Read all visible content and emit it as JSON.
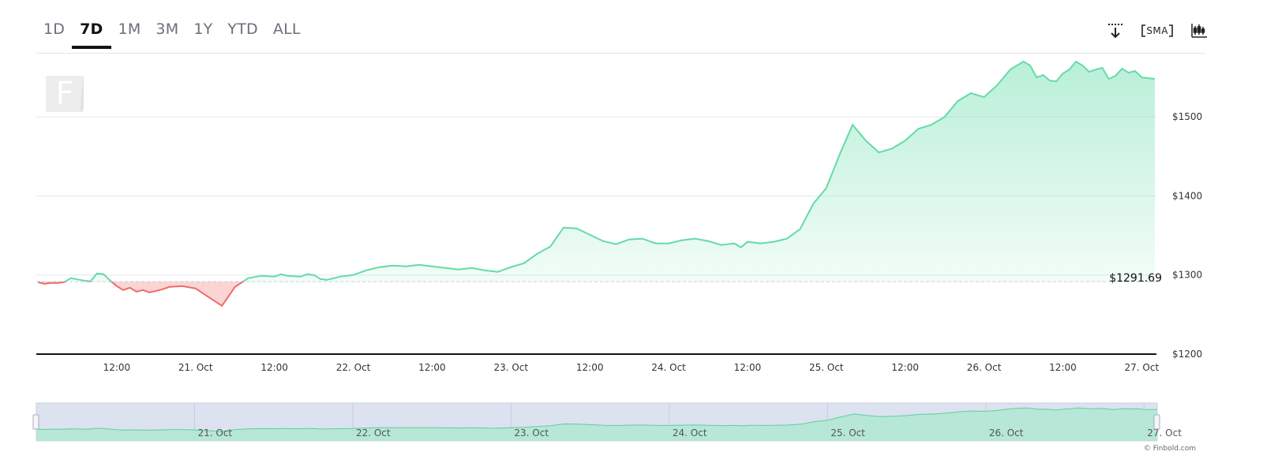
{
  "range_tabs": [
    {
      "label": "1D",
      "active": false
    },
    {
      "label": "7D",
      "active": true
    },
    {
      "label": "1M",
      "active": false
    },
    {
      "label": "3M",
      "active": false
    },
    {
      "label": "1Y",
      "active": false
    },
    {
      "label": "YTD",
      "active": false
    },
    {
      "label": "ALL",
      "active": false
    }
  ],
  "toolbar": {
    "download_icon": "download-icon",
    "sma_label": "SMA",
    "candlestick_icon": "candlestick-icon"
  },
  "watermark_letter": "F",
  "credit": "© Finbold.com",
  "colors": {
    "up": "#64dba6",
    "down": "#f06a6a",
    "up_fill": "#c9f3df",
    "down_fill": "#fbd4d4",
    "axis": "#111318",
    "grid": "#e6e8ec",
    "navigator_bg": "#dde2f0"
  },
  "chart_data": {
    "type": "line",
    "reference_value": 1291.69,
    "reference_label": "$1291.69",
    "ylim": [
      1200,
      1580
    ],
    "y_ticks": [
      1200,
      1300,
      1400,
      1500
    ],
    "y_tick_labels": [
      "$1200",
      "$1300",
      "$1400",
      "$1500"
    ],
    "x_tick_labels": [
      "12:00",
      "21. Oct",
      "12:00",
      "22. Oct",
      "12:00",
      "23. Oct",
      "12:00",
      "24. Oct",
      "12:00",
      "25. Oct",
      "12:00",
      "26. Oct",
      "12:00",
      "27. Oct"
    ],
    "navigator_labels": [
      "21. Oct",
      "22. Oct",
      "23. Oct",
      "24. Oct",
      "25. Oct",
      "26. Oct",
      "27. Oct"
    ],
    "x_unit": "hour",
    "x_range": [
      0,
      170
    ],
    "x": [
      0,
      1,
      2,
      3,
      4,
      5,
      7,
      8,
      9,
      10,
      11,
      12,
      13,
      14,
      15,
      16,
      17,
      18,
      19,
      20,
      22,
      24,
      26,
      28,
      30,
      32,
      34,
      36,
      37,
      38,
      40,
      41,
      42,
      43,
      44,
      46,
      48,
      50,
      52,
      54,
      56,
      58,
      60,
      62,
      64,
      66,
      68,
      70,
      72,
      74,
      76,
      78,
      80,
      82,
      84,
      86,
      88,
      90,
      92,
      94,
      96,
      98,
      100,
      102,
      104,
      106,
      107,
      108,
      109,
      110,
      112,
      114,
      116,
      118,
      120,
      122,
      124,
      126,
      128,
      130,
      132,
      134,
      136,
      138,
      140,
      142,
      144,
      146,
      148,
      150,
      151,
      152,
      153,
      154,
      155,
      156,
      157,
      158,
      159,
      160,
      161,
      162,
      163,
      164,
      165,
      166,
      167,
      168,
      170
    ],
    "values": [
      1291,
      1289,
      1290,
      1290,
      1291,
      1296,
      1293,
      1292,
      1302,
      1301,
      1293,
      1286,
      1281,
      1284,
      1279,
      1281,
      1278,
      1280,
      1282,
      1285,
      1286,
      1283,
      1272,
      1261,
      1285,
      1296,
      1299,
      1298,
      1301,
      1299,
      1298,
      1301,
      1300,
      1295,
      1294,
      1298,
      1300,
      1306,
      1310,
      1312,
      1311,
      1313,
      1311,
      1309,
      1307,
      1309,
      1306,
      1304,
      1310,
      1315,
      1327,
      1336,
      1360,
      1359,
      1351,
      1343,
      1339,
      1345,
      1346,
      1340,
      1340,
      1344,
      1346,
      1343,
      1338,
      1340,
      1335,
      1342,
      1341,
      1340,
      1342,
      1346,
      1358,
      1390,
      1410,
      1452,
      1490,
      1470,
      1455,
      1460,
      1470,
      1485,
      1490,
      1500,
      1520,
      1530,
      1525,
      1540,
      1560,
      1570,
      1565,
      1550,
      1553,
      1546,
      1545,
      1555,
      1560,
      1570,
      1565,
      1557,
      1560,
      1562,
      1548,
      1552,
      1561,
      1556,
      1558,
      1550,
      1548
    ]
  }
}
